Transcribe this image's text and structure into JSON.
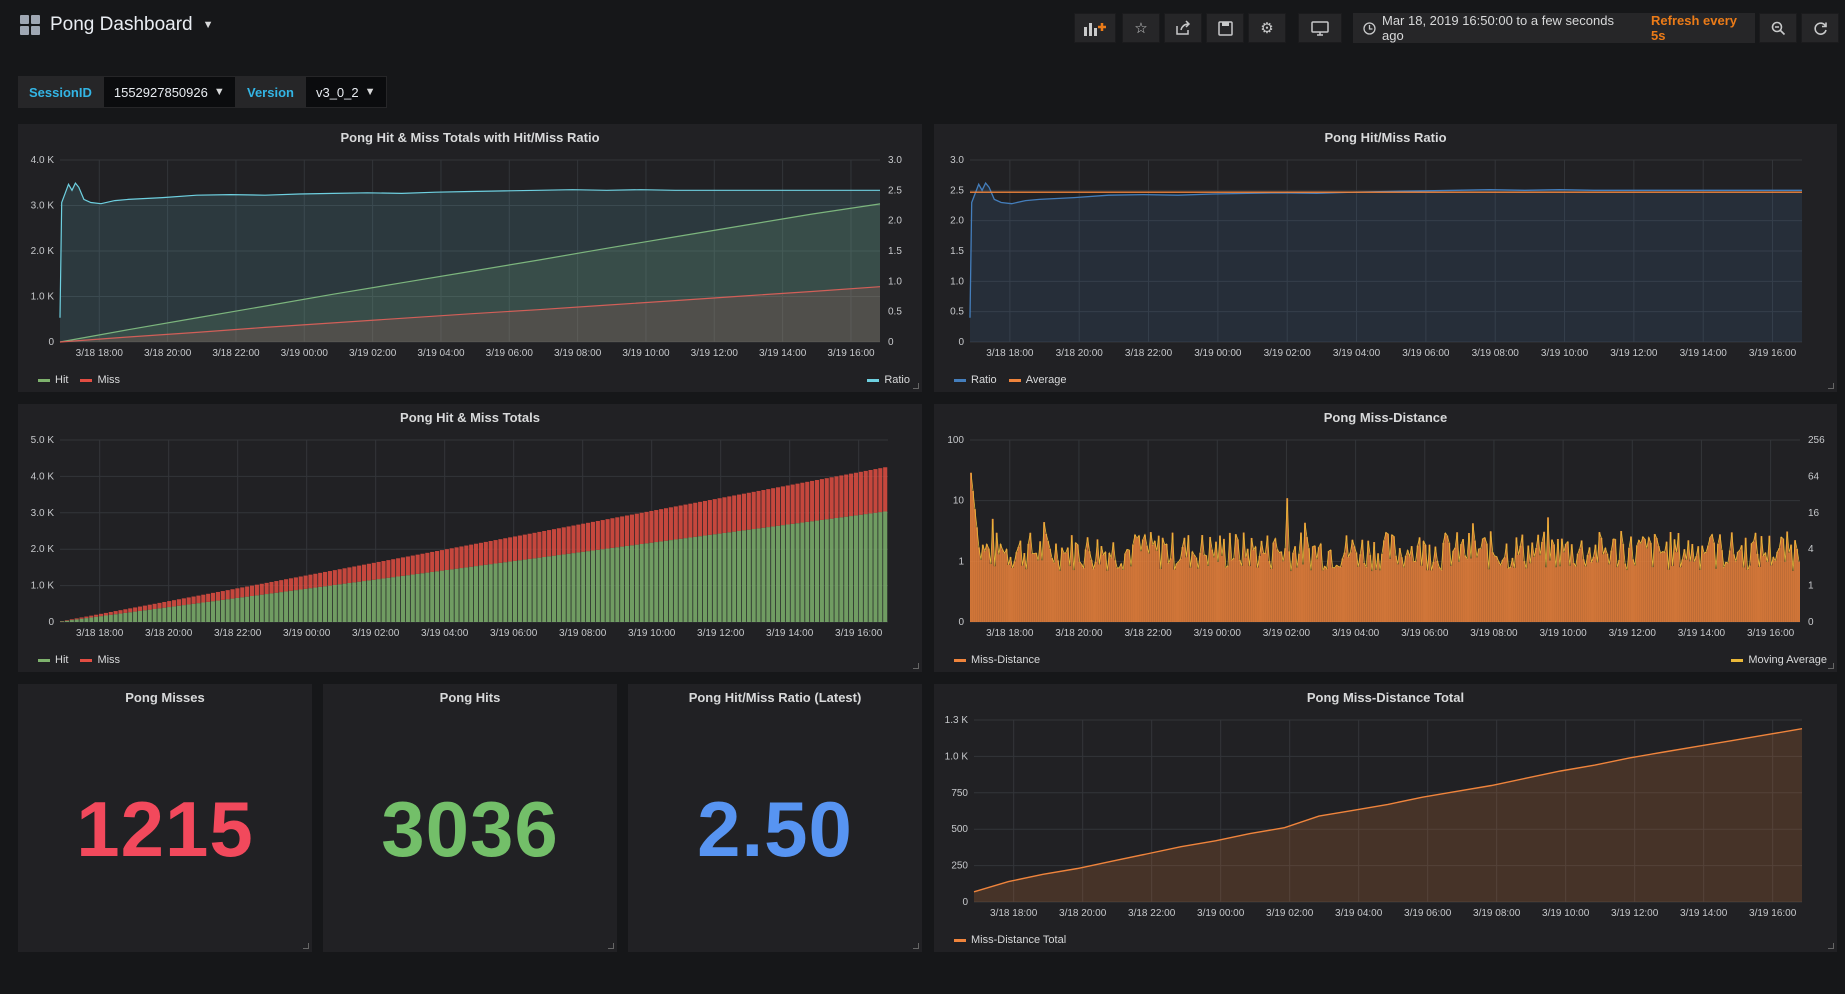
{
  "header": {
    "title": "Pong Dashboard",
    "time_range": "Mar 18, 2019 16:50:00 to a few seconds ago",
    "refresh": "Refresh every 5s"
  },
  "variables": [
    {
      "label": "SessionID",
      "value": "1552927850926"
    },
    {
      "label": "Version",
      "value": "v3_0_2"
    }
  ],
  "icons": [
    "add-panel-icon",
    "star-icon",
    "share-icon",
    "save-icon",
    "gear-icon",
    "tv-icon",
    "clock-icon",
    "zoom-out-icon",
    "refresh-icon"
  ],
  "colors": {
    "hit": "#7eb26d",
    "miss": "#e24d42",
    "ratio_cyan": "#6ed0e0",
    "ratio_blue": "#447ebc",
    "average": "#ef843c",
    "stat_miss": "#f2495c",
    "stat_hit": "#73bf69",
    "stat_ratio": "#5794f2",
    "orange": "#eab839"
  },
  "panels": {
    "p1": {
      "title": "Pong Hit & Miss Totals with Hit/Miss Ratio",
      "legend_left": [
        "Hit",
        "Miss"
      ],
      "legend_right": [
        "Ratio"
      ]
    },
    "p2": {
      "title": "Pong Hit/Miss Ratio",
      "legend": [
        "Ratio",
        "Average"
      ]
    },
    "p3": {
      "title": "Pong Hit & Miss Totals",
      "legend": [
        "Hit",
        "Miss"
      ]
    },
    "p4": {
      "title": "Pong Miss-Distance",
      "legend_left": [
        "Miss-Distance"
      ],
      "legend_right": [
        "Moving Average"
      ]
    },
    "p5": {
      "title": "Pong Misses",
      "value": "1215"
    },
    "p6": {
      "title": "Pong Hits",
      "value": "3036"
    },
    "p7": {
      "title": "Pong Hit/Miss Ratio (Latest)",
      "value": "2.50"
    },
    "p8": {
      "title": "Pong Miss-Distance Total",
      "legend": [
        "Miss-Distance Total"
      ]
    }
  },
  "chart_data": [
    {
      "id": "p1",
      "type": "area",
      "x_ticks": [
        "3/18 18:00",
        "3/18 20:00",
        "3/18 22:00",
        "3/19 00:00",
        "3/19 02:00",
        "3/19 04:00",
        "3/19 06:00",
        "3/19 08:00",
        "3/19 10:00",
        "3/19 12:00",
        "3/19 14:00",
        "3/19 16:00"
      ],
      "y_ticks_left": [
        "0",
        "1.0 K",
        "2.0 K",
        "3.0 K",
        "4.0 K"
      ],
      "ylim_left": [
        0,
        4000
      ],
      "y_ticks_right": [
        "0",
        "0.5",
        "1.0",
        "1.5",
        "2.0",
        "2.5",
        "3.0"
      ],
      "ylim_right": [
        0,
        3
      ],
      "series": [
        {
          "name": "Hit",
          "axis": "left",
          "x": [
            0,
            2,
            4,
            6,
            8,
            10,
            12,
            14,
            16,
            18,
            20,
            22,
            24
          ],
          "y": [
            0,
            270,
            530,
            790,
            1050,
            1300,
            1550,
            1800,
            2060,
            2310,
            2560,
            2810,
            3036
          ]
        },
        {
          "name": "Miss",
          "axis": "left",
          "x": [
            0,
            2,
            4,
            6,
            8,
            10,
            12,
            14,
            16,
            18,
            20,
            22,
            24
          ],
          "y": [
            0,
            110,
            210,
            320,
            420,
            520,
            620,
            710,
            810,
            910,
            1010,
            1110,
            1215
          ]
        },
        {
          "name": "Ratio",
          "axis": "right",
          "x": [
            0,
            0.05,
            0.15,
            0.25,
            0.35,
            0.45,
            0.55,
            0.7,
            0.9,
            1.2,
            1.6,
            2,
            3,
            4,
            5,
            6,
            7,
            8,
            9,
            10,
            11,
            12,
            13,
            14,
            15,
            16,
            17,
            18,
            19,
            20,
            21,
            22,
            23,
            24
          ],
          "y": [
            0.4,
            2.3,
            2.45,
            2.6,
            2.5,
            2.62,
            2.55,
            2.35,
            2.3,
            2.28,
            2.33,
            2.35,
            2.38,
            2.42,
            2.43,
            2.42,
            2.44,
            2.45,
            2.46,
            2.45,
            2.47,
            2.48,
            2.49,
            2.5,
            2.51,
            2.5,
            2.51,
            2.5,
            2.5,
            2.5,
            2.5,
            2.5,
            2.5,
            2.5
          ]
        }
      ]
    },
    {
      "id": "p2",
      "type": "line",
      "x_ticks": [
        "3/18 18:00",
        "3/18 20:00",
        "3/18 22:00",
        "3/19 00:00",
        "3/19 02:00",
        "3/19 04:00",
        "3/19 06:00",
        "3/19 08:00",
        "3/19 10:00",
        "3/19 12:00",
        "3/19 14:00",
        "3/19 16:00"
      ],
      "y_ticks": [
        "0",
        "0.5",
        "1.0",
        "1.5",
        "2.0",
        "2.5",
        "3.0"
      ],
      "ylim": [
        0,
        3
      ],
      "series": [
        {
          "name": "Ratio",
          "x": [
            0,
            0.05,
            0.15,
            0.25,
            0.35,
            0.45,
            0.55,
            0.7,
            0.9,
            1.2,
            1.6,
            2,
            3,
            4,
            5,
            6,
            7,
            8,
            9,
            10,
            11,
            12,
            13,
            14,
            15,
            16,
            17,
            18,
            19,
            20,
            21,
            22,
            23,
            24
          ],
          "y": [
            0.4,
            2.3,
            2.45,
            2.6,
            2.5,
            2.62,
            2.55,
            2.35,
            2.3,
            2.28,
            2.33,
            2.35,
            2.38,
            2.42,
            2.43,
            2.42,
            2.44,
            2.45,
            2.46,
            2.45,
            2.47,
            2.48,
            2.49,
            2.5,
            2.51,
            2.5,
            2.51,
            2.5,
            2.5,
            2.5,
            2.5,
            2.5,
            2.5,
            2.5
          ]
        },
        {
          "name": "Average",
          "x": [
            0,
            24
          ],
          "y": [
            2.47,
            2.47
          ]
        }
      ]
    },
    {
      "id": "p3",
      "type": "bar",
      "x_ticks": [
        "3/18 18:00",
        "3/18 20:00",
        "3/18 22:00",
        "3/19 00:00",
        "3/19 02:00",
        "3/19 04:00",
        "3/19 06:00",
        "3/19 08:00",
        "3/19 10:00",
        "3/19 12:00",
        "3/19 14:00",
        "3/19 16:00"
      ],
      "y_ticks": [
        "0",
        "1.0 K",
        "2.0 K",
        "3.0 K",
        "4.0 K",
        "5.0 K"
      ],
      "ylim": [
        0,
        5000
      ],
      "stacked": true,
      "series": [
        {
          "name": "Hit",
          "x": [
            0,
            24
          ],
          "y": [
            0,
            3036
          ]
        },
        {
          "name": "Miss",
          "x": [
            0,
            24
          ],
          "y": [
            0,
            1215
          ]
        }
      ]
    },
    {
      "id": "p4",
      "type": "bar",
      "x_ticks": [
        "3/18 18:00",
        "3/18 20:00",
        "3/18 22:00",
        "3/19 00:00",
        "3/19 02:00",
        "3/19 04:00",
        "3/19 06:00",
        "3/19 08:00",
        "3/19 10:00",
        "3/19 12:00",
        "3/19 14:00",
        "3/19 16:00"
      ],
      "y_ticks_left": [
        "0",
        "1",
        "10",
        "100"
      ],
      "y_ticks_right": [
        "0",
        "1",
        "4",
        "16",
        "64",
        "256"
      ],
      "series": [
        {
          "name": "Miss-Distance"
        },
        {
          "name": "Moving Average"
        }
      ]
    },
    {
      "id": "p8",
      "type": "area",
      "x_ticks": [
        "3/18 18:00",
        "3/18 20:00",
        "3/18 22:00",
        "3/19 00:00",
        "3/19 02:00",
        "3/19 04:00",
        "3/19 06:00",
        "3/19 08:00",
        "3/19 10:00",
        "3/19 12:00",
        "3/19 14:00",
        "3/19 16:00"
      ],
      "y_ticks": [
        "0",
        "250",
        "500",
        "750",
        "1.0 K",
        "1.3 K"
      ],
      "ylim": [
        0,
        1250
      ],
      "series": [
        {
          "name": "Miss-Distance Total",
          "x": [
            0,
            1,
            2,
            3,
            4,
            5,
            6,
            7,
            8,
            9,
            10,
            11,
            12,
            13,
            14,
            15,
            16,
            17,
            18,
            19,
            20,
            21,
            22,
            23,
            24
          ],
          "y": [
            70,
            140,
            190,
            230,
            280,
            330,
            380,
            420,
            470,
            510,
            590,
            630,
            670,
            720,
            760,
            800,
            850,
            900,
            940,
            990,
            1030,
            1070,
            1110,
            1150,
            1190
          ]
        }
      ]
    }
  ]
}
